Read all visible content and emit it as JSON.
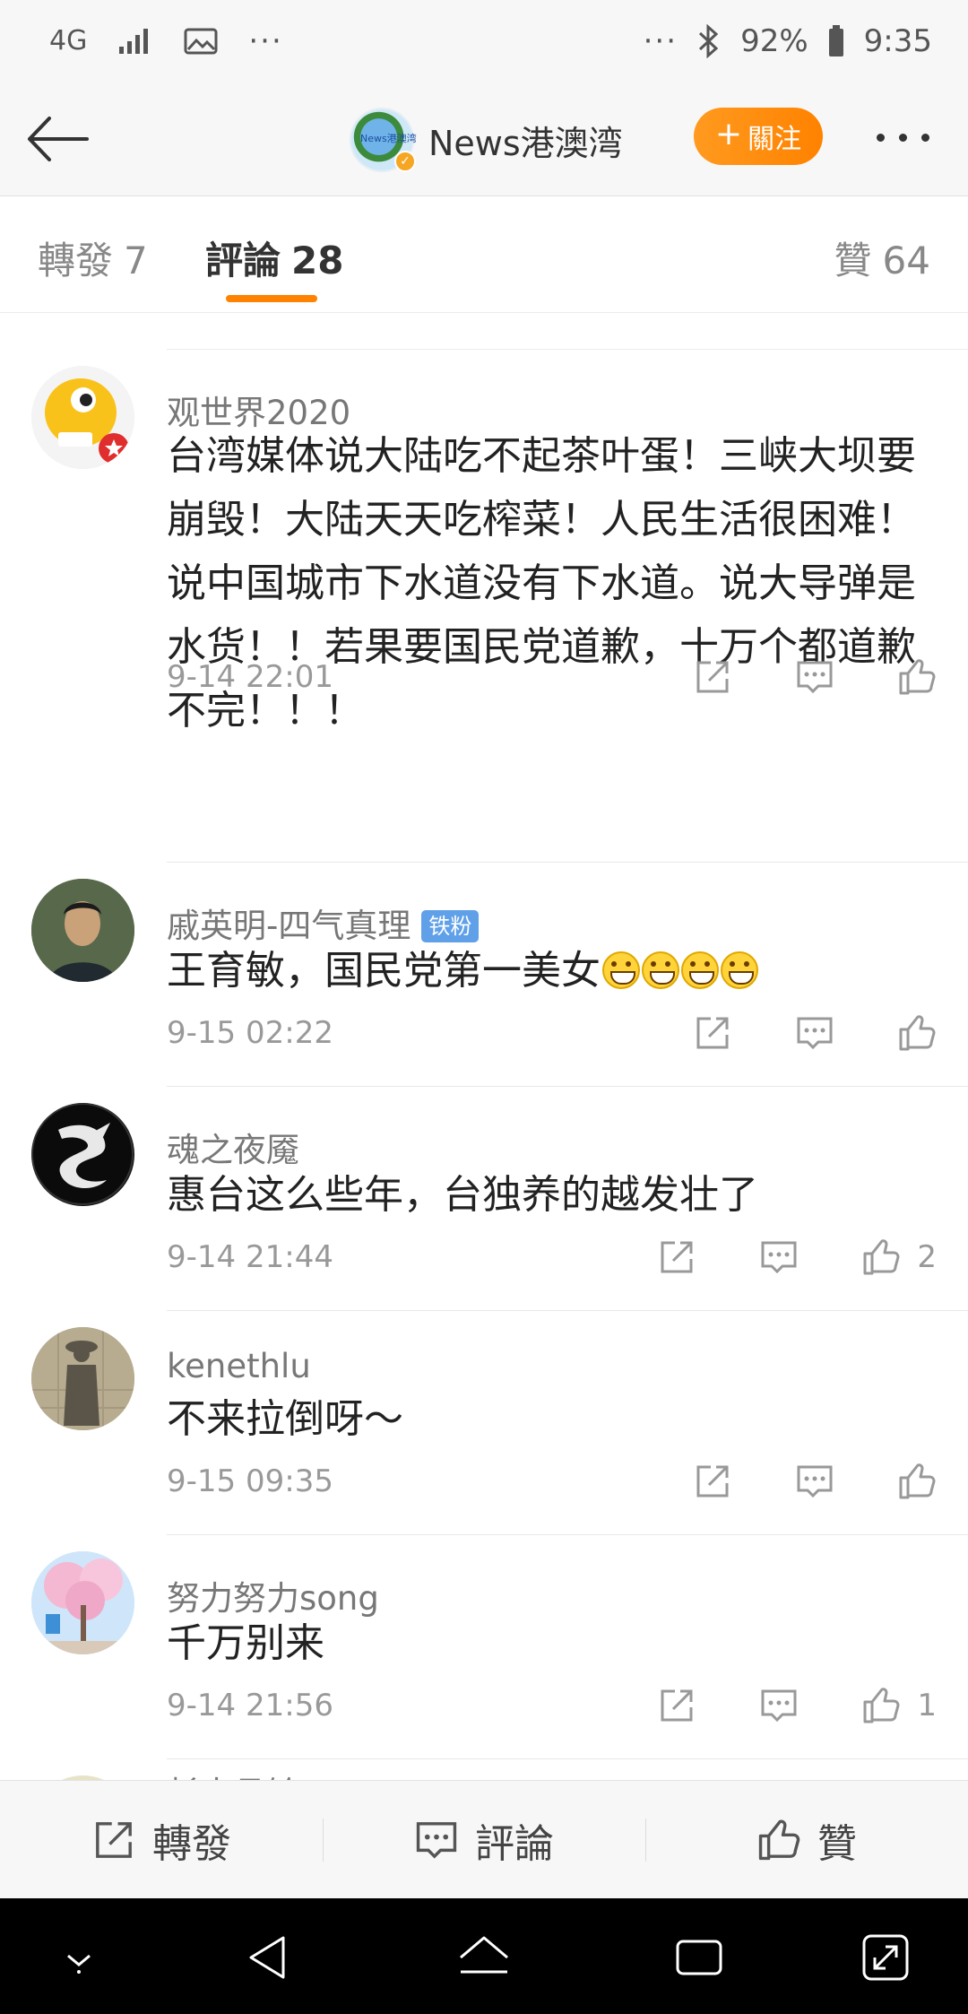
{
  "status_bar": {
    "network": "4G",
    "more": "···",
    "more_right": "···",
    "battery": "92%",
    "time": "9:35"
  },
  "nav": {
    "account_name": "News港澳湾",
    "avatar_text": "News港澳湾",
    "follow_label": "關注",
    "follow_plus": "+"
  },
  "tabs": {
    "repost": {
      "label": "轉發",
      "count": "7"
    },
    "comments": {
      "label": "評論",
      "count": "28"
    },
    "likes": {
      "label": "贊",
      "count": "64"
    }
  },
  "comments": [
    {
      "name": "观世界2020",
      "text": "台湾媒体说大陆吃不起茶叶蛋！三峡大坝要崩毁！大陆天天吃榨菜！人民生活很困难！说中国城市下水道没有下水道。说大导弹是水货！！若果要国民党道歉，十万个都道歉不完！！！",
      "time": "9-14 22:01",
      "likes": ""
    },
    {
      "name": "戚英明-四气真理",
      "badge": "铁粉",
      "text": "王育敏，国民党第一美女",
      "time": "9-15 02:22",
      "likes": ""
    },
    {
      "name": "魂之夜魇",
      "text": "惠台这么些年，台独养的越发壮了",
      "time": "9-14 21:44",
      "likes": "2"
    },
    {
      "name": "kenethlu",
      "text": "不来拉倒呀～",
      "time": "9-15 09:35",
      "likes": ""
    },
    {
      "name": "努力努力song",
      "text": "千万别来",
      "time": "9-14 21:56",
      "likes": "1"
    },
    {
      "name": "杉水县铃",
      "text": "",
      "time": "",
      "likes": ""
    }
  ],
  "bottom_bar": {
    "repost": "轉發",
    "comment": "評論",
    "like": "贊"
  },
  "colors": {
    "accent": "#ff8200",
    "fan_badge": "#5fa0e8",
    "muted_text": "#999999"
  }
}
